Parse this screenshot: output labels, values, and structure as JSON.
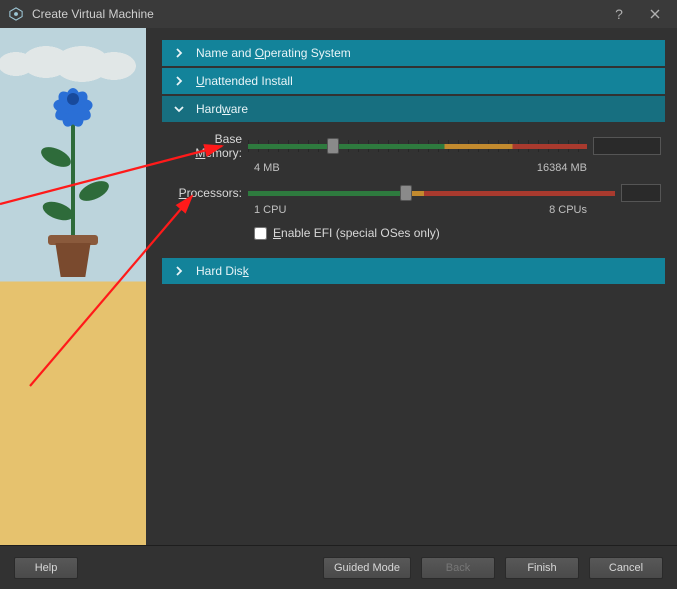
{
  "window": {
    "title": "Create Virtual Machine"
  },
  "sections": {
    "name_os": {
      "label": "Name and Operating System"
    },
    "unattended": {
      "label": "Unattended Install"
    },
    "hardware": {
      "label": "Hardware"
    },
    "hard_disk": {
      "label": "Hard Disk"
    }
  },
  "hardware": {
    "base_memory_label": "Base Memory:",
    "base_memory_value": "4096",
    "base_memory_unit": "MB",
    "base_memory_min": "4 MB",
    "base_memory_max": "16384 MB",
    "processors_label": "Processors:",
    "processors_value": "4",
    "processors_min": "1 CPU",
    "processors_max": "8 CPUs",
    "efi_label": "Enable EFI (special OSes only)"
  },
  "footer": {
    "help": "Help",
    "guided": "Guided Mode",
    "back": "Back",
    "finish": "Finish",
    "cancel": "Cancel"
  }
}
